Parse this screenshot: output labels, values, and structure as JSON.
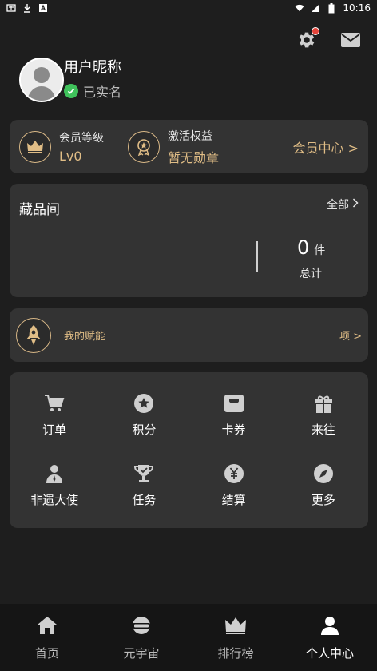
{
  "status_bar": {
    "left_icons": [
      "app-icon",
      "download-icon",
      "a-icon"
    ],
    "time": "10:16"
  },
  "header": {
    "settings_icon": "gear-icon",
    "has_notification": true,
    "mail_icon": "mail-icon"
  },
  "profile": {
    "nickname": "用户昵称",
    "verified_text": "已实名"
  },
  "member": {
    "level_label": "会员等级",
    "level_value": "Lv0",
    "benefit_label": "激活权益",
    "benefit_value": "暂无勋章",
    "center_link": "会员中心 >"
  },
  "collection": {
    "title": "藏品间",
    "all_link": "全部",
    "count": "0",
    "count_unit": "件",
    "total_label": "总计"
  },
  "talent": {
    "label": "我的赋能",
    "right_text": "项 >"
  },
  "grid_items": [
    {
      "label": "订单",
      "icon": "cart-icon"
    },
    {
      "label": "积分",
      "icon": "points-icon"
    },
    {
      "label": "卡券",
      "icon": "card-icon"
    },
    {
      "label": "来往",
      "icon": "gift-icon"
    },
    {
      "label": "非遗大使",
      "icon": "ambassador-icon"
    },
    {
      "label": "任务",
      "icon": "trophy-icon"
    },
    {
      "label": "结算",
      "icon": "yen-icon"
    },
    {
      "label": "更多",
      "icon": "compass-icon"
    }
  ],
  "bottom_nav": [
    {
      "label": "首页",
      "icon": "home-icon",
      "active": false
    },
    {
      "label": "元宇宙",
      "icon": "vr-icon",
      "active": false
    },
    {
      "label": "排行榜",
      "icon": "crown-icon",
      "active": false
    },
    {
      "label": "个人中心",
      "icon": "user-icon",
      "active": true
    }
  ],
  "colors": {
    "accent_gold": "#e0bd86",
    "card_bg": "#333333",
    "page_bg": "#1e1e1e",
    "badge_red": "#e5443a",
    "verified_green": "#3fc25b"
  }
}
